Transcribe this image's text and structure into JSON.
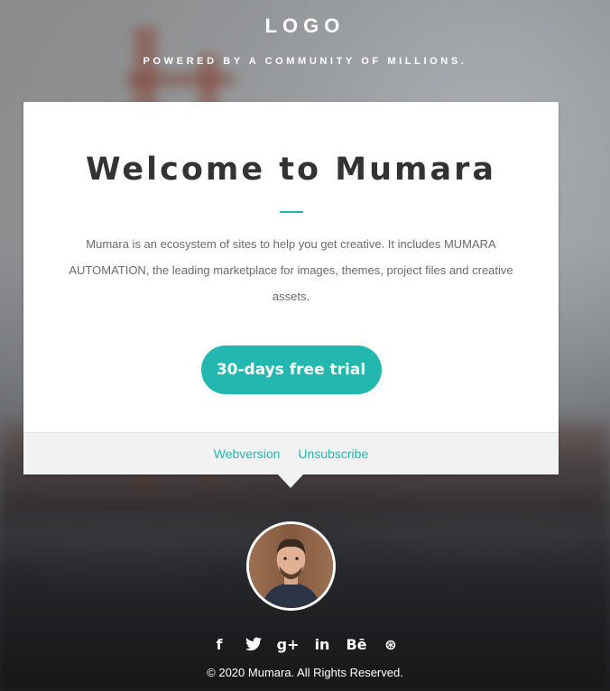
{
  "header": {
    "logo": "LOGO",
    "tagline": "POWERED BY A COMMUNITY OF MILLIONS."
  },
  "card": {
    "title": "Welcome to Mumara",
    "description": "Mumara is an ecosystem of sites to help you get creative. It includes MUMARA AUTOMATION, the leading marketplace for images, themes, project files and creative assets.",
    "cta_label": "30-days free trial"
  },
  "links": {
    "webversion": "Webversion",
    "unsubscribe": "Unsubscribe"
  },
  "social": {
    "icons": [
      "facebook-icon",
      "twitter-icon",
      "google-plus-icon",
      "linkedin-icon",
      "behance-icon",
      "dribbble-icon"
    ],
    "facebook": "f",
    "twitter": "🐦",
    "google": "g+",
    "linkedin": "in",
    "behance": "Bē",
    "dribbble": "⊛"
  },
  "footer": {
    "copyright": "© 2020 Mumara. All Rights Reserved."
  },
  "colors": {
    "accent": "#22b8b0",
    "title": "#333333"
  }
}
